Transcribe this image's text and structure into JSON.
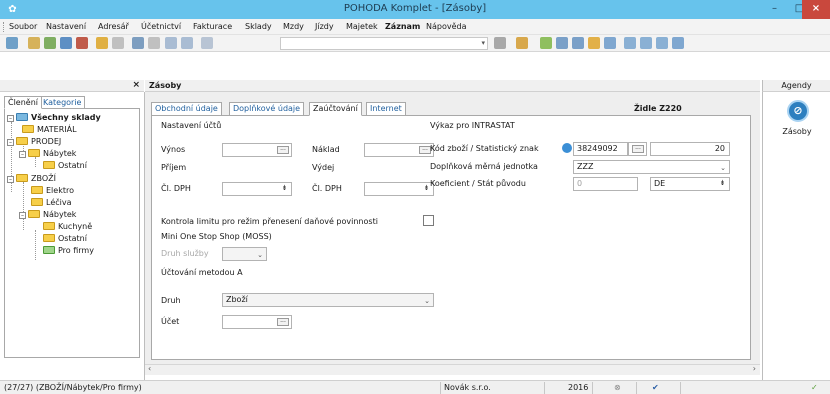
{
  "window": {
    "title": "POHODA Komplet - [Zásoby]",
    "app_icon": "pohoda-app-icon",
    "minimize": "–",
    "maximize": "□",
    "close": "×"
  },
  "menu": [
    {
      "label": "Soubor",
      "bold": false
    },
    {
      "label": "Nastavení",
      "bold": false
    },
    {
      "label": "Adresář",
      "bold": false
    },
    {
      "label": "Účetnictví",
      "bold": false
    },
    {
      "label": "Fakturace",
      "bold": false
    },
    {
      "label": "Sklady",
      "bold": false
    },
    {
      "label": "Mzdy",
      "bold": false
    },
    {
      "label": "Jízdy",
      "bold": false
    },
    {
      "label": "Majetek",
      "bold": false
    },
    {
      "label": "Záznam",
      "bold": true
    },
    {
      "label": "Nápověda",
      "bold": false
    }
  ],
  "left_panel": {
    "close_label": "×",
    "tabs": [
      "Členění",
      "Kategorie"
    ],
    "tree": [
      {
        "label": "Všechny sklady",
        "level": 0,
        "bold": true,
        "toggle": "–"
      },
      {
        "label": "MATERIÁL",
        "level": 1,
        "toggle": ""
      },
      {
        "label": "PRODEJ",
        "level": 1,
        "toggle": "–"
      },
      {
        "label": "Nábytek",
        "level": 2,
        "toggle": "–"
      },
      {
        "label": "Ostatní",
        "level": 3,
        "toggle": ""
      },
      {
        "label": "ZBOŽÍ",
        "level": 1,
        "toggle": "–"
      },
      {
        "label": "Elektro",
        "level": 2,
        "toggle": ""
      },
      {
        "label": "Léčiva",
        "level": 2,
        "toggle": ""
      },
      {
        "label": "Nábytek",
        "level": 2,
        "toggle": "–"
      },
      {
        "label": "Kuchyně",
        "level": 3,
        "toggle": ""
      },
      {
        "label": "Ostatní",
        "level": 3,
        "toggle": ""
      },
      {
        "label": "Pro firmy",
        "level": 3,
        "toggle": "",
        "selected": true
      }
    ]
  },
  "main": {
    "header": "Zásoby",
    "tabs": [
      "Obchodní údaje",
      "Doplňkové údaje",
      "Zaúčtování",
      "Internet"
    ],
    "active_tab": "Zaúčtování",
    "product_name": "Židle Z220",
    "nastaveni_uctu": "Nastavení účtů",
    "vynos": "Výnos",
    "naklad": "Náklad",
    "prijem": "Příjem",
    "vydej": "Výdej",
    "cl_dph": "Čl. DPH",
    "cl_dph2": "Čl. DPH",
    "kontrola_limitu": "Kontrola limitu pro režim přenesení daňové povinnosti",
    "moss_title": "Mini One Stop Shop (MOSS)",
    "druh_sluzby": "Druh služby",
    "ucetni_metoda": "Účtování metodou A",
    "druh": "Druh",
    "druh_value": "Zboží",
    "ucet": "Účet",
    "intrastat": {
      "title": "Výkaz pro INTRASTAT",
      "kod_label": "Kód zboží / Statistický znak",
      "kod_value": "38249092",
      "stat_znak": "20",
      "dopl_label": "Doplňková měrná jednotka",
      "dopl_value": "ZZZ",
      "koef_label": "Koeficient / Stát původu",
      "koef_value": "0",
      "stat_value": "DE"
    }
  },
  "agendy": {
    "header": "Agendy",
    "item": "Zásoby"
  },
  "statusbar": {
    "record": "(27/27) (ZBOŽÍ/Nábytek/Pro firmy)",
    "company": "Novák s.r.o.",
    "year": "2016"
  },
  "colors": {
    "titlebar": "#67c3ec",
    "close": "#c9483d",
    "link": "#1f5f9e"
  }
}
